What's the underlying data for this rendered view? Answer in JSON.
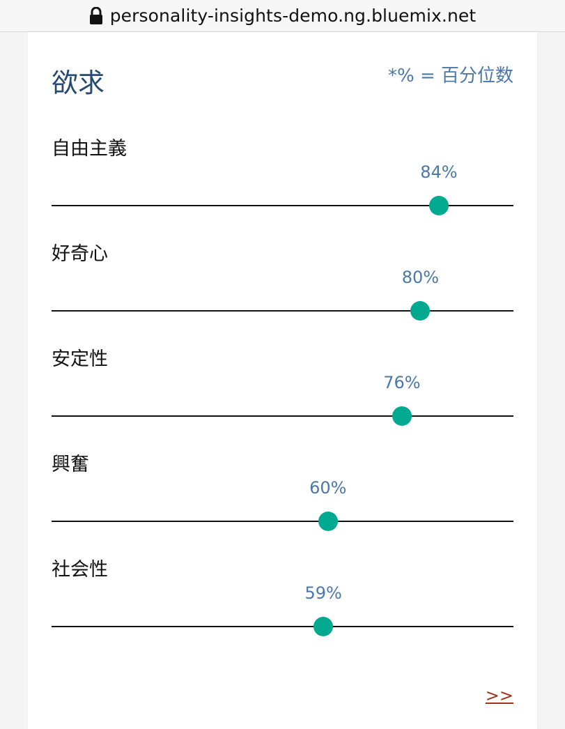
{
  "browser": {
    "url": "personality-insights-demo.ng.bluemix.net"
  },
  "card": {
    "title": "欲求",
    "note": "*% = 百分位数",
    "traits": [
      {
        "name": "自由主義",
        "value_label": "84%",
        "value": 84
      },
      {
        "name": "好奇心",
        "value_label": "80%",
        "value": 80
      },
      {
        "name": "安定性",
        "value_label": "76%",
        "value": 76
      },
      {
        "name": "興奮",
        "value_label": "60%",
        "value": 60
      },
      {
        "name": "社会性",
        "value_label": "59%",
        "value": 59
      }
    ],
    "next_label": ">>"
  },
  "colors": {
    "accent_knob": "#00a98f",
    "value_text": "#4a78aa",
    "title_text": "#254a6e",
    "link": "#a0311c"
  }
}
